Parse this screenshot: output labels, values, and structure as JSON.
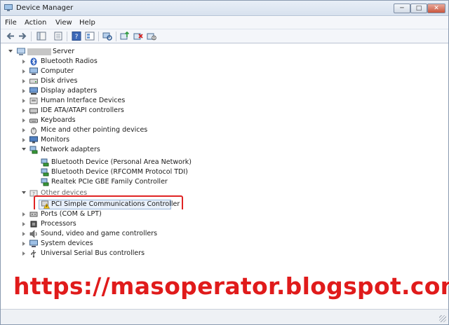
{
  "window": {
    "title": "Device Manager"
  },
  "controls": {
    "minimize": "─",
    "maximize": "□",
    "close": "✕"
  },
  "menu": [
    "File",
    "Action",
    "View",
    "Help"
  ],
  "tree": {
    "root_label": "Server",
    "categories": [
      {
        "label": "Bluetooth Radios",
        "icon": "bluetooth-icon"
      },
      {
        "label": "Computer",
        "icon": "computer-icon"
      },
      {
        "label": "Disk drives",
        "icon": "disk-drive-icon"
      },
      {
        "label": "Display adapters",
        "icon": "display-adapter-icon"
      },
      {
        "label": "Human Interface Devices",
        "icon": "hid-icon"
      },
      {
        "label": "IDE ATA/ATAPI controllers",
        "icon": "ide-controller-icon"
      },
      {
        "label": "Keyboards",
        "icon": "keyboard-icon"
      },
      {
        "label": "Mice and other pointing devices",
        "icon": "mouse-icon"
      },
      {
        "label": "Monitors",
        "icon": "monitor-icon"
      }
    ],
    "network": {
      "label": "Network adapters",
      "children": [
        "Bluetooth Device (Personal Area Network)",
        "Bluetooth Device (RFCOMM Protocol TDI)",
        "Realtek PCIe GBE Family Controller"
      ]
    },
    "other": {
      "label": "Other devices",
      "children": [
        "PCI Simple Communications Controller"
      ]
    },
    "rest": [
      {
        "label": "Ports (COM & LPT)",
        "icon": "port-icon"
      },
      {
        "label": "Processors",
        "icon": "processor-icon"
      },
      {
        "label": "Sound, video and game controllers",
        "icon": "sound-icon"
      },
      {
        "label": "System devices",
        "icon": "system-device-icon"
      },
      {
        "label": "Universal Serial Bus controllers",
        "icon": "usb-icon"
      }
    ]
  },
  "watermark": "https://masoperator.blogspot.com",
  "colors": {
    "highlight": "#e02424",
    "watermark": "#e01b1b",
    "selection": "#e8f0fb"
  }
}
